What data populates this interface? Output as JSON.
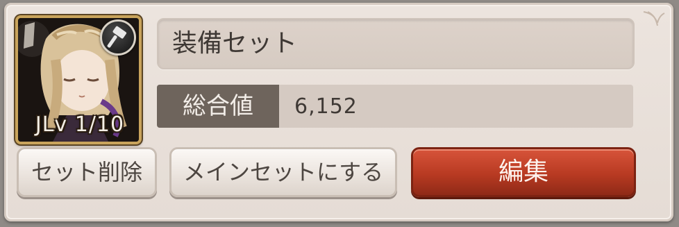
{
  "character": {
    "level_text": "JLv 1/10",
    "weapon_badge_icon": "hammer-icon"
  },
  "equipment_set": {
    "name": "装備セット",
    "stat_label": "総合値",
    "stat_value": "6,152"
  },
  "buttons": {
    "delete_label": "セット削除",
    "main_set_label": "メインセットにする",
    "edit_label": "編集"
  },
  "colors": {
    "panel_bg": "#e8e0d9",
    "edit_button": "#b83a22",
    "stat_label_bg": "#6e645c"
  }
}
